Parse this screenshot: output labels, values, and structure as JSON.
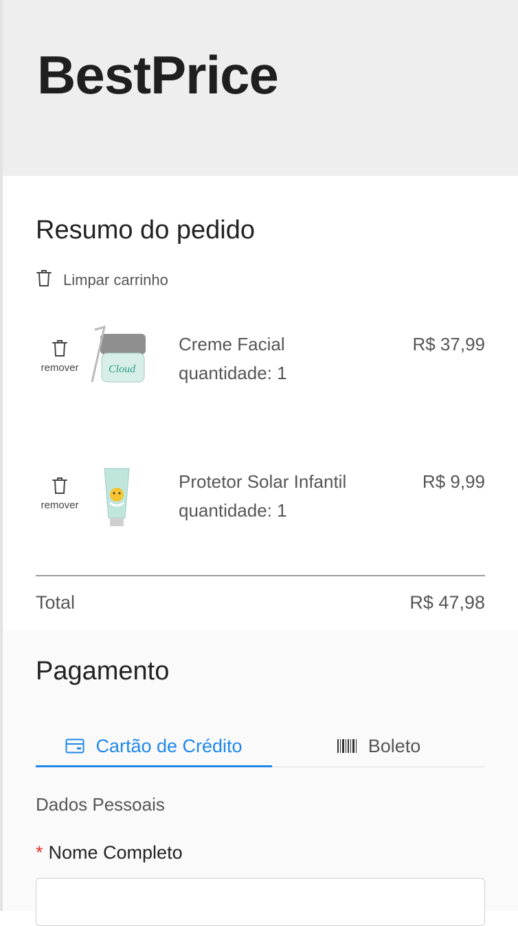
{
  "brand": {
    "logo": "BestPrice"
  },
  "summary": {
    "title": "Resumo do pedido",
    "clear_label": "Limpar carrinho",
    "remove_label": "remover",
    "items": [
      {
        "name": "Creme Facial",
        "quantity_text": "quantidade: 1",
        "price": "R$ 37,99",
        "image_icon": "cream-jar-icon"
      },
      {
        "name": "Protetor Solar Infantil",
        "quantity_text": "quantidade: 1",
        "price": "R$ 9,99",
        "image_icon": "sunscreen-tube-icon"
      }
    ],
    "total_label": "Total",
    "total_value": "R$ 47,98"
  },
  "payment": {
    "title": "Pagamento",
    "tabs": [
      {
        "label": "Cartão de Crédito",
        "icon": "credit-card-icon",
        "active": true
      },
      {
        "label": "Boleto",
        "icon": "barcode-icon",
        "active": false
      }
    ],
    "section_title": "Dados Pessoais",
    "name_field": {
      "label": "Nome Completo",
      "required_mark": "*",
      "value": "",
      "placeholder": ""
    }
  },
  "colors": {
    "accent": "#1f87e8",
    "header_bg": "#eeeeee",
    "required": "#e0312c",
    "text": "#555555"
  }
}
